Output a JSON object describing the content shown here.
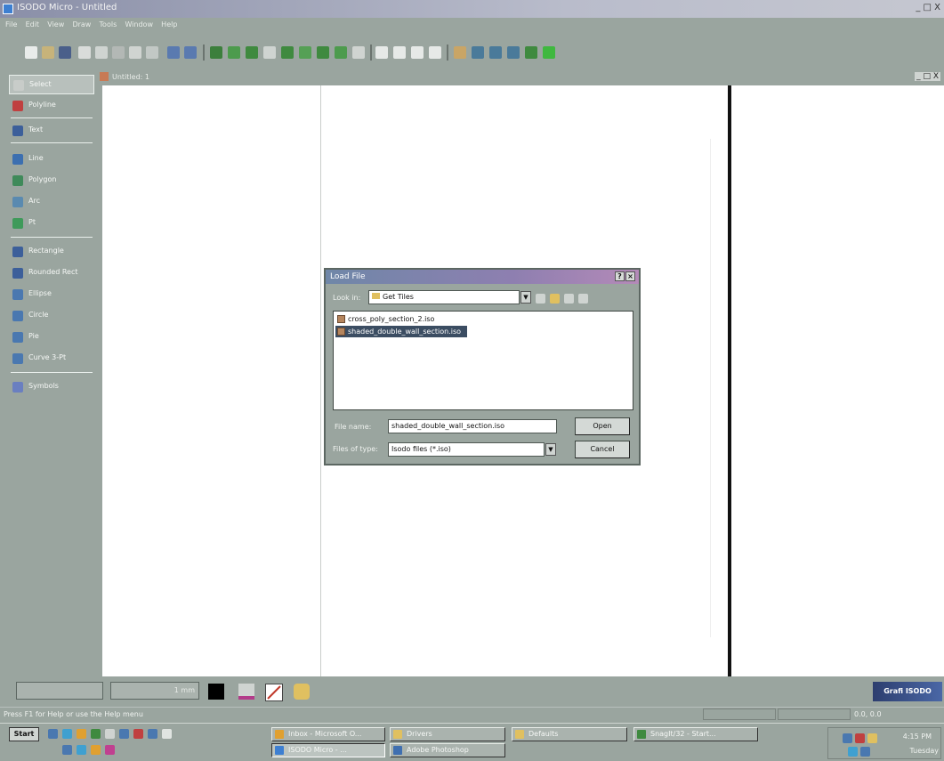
{
  "window": {
    "title": "ISODO Micro - Untitled",
    "controls": "_ □ X"
  },
  "menu": [
    "File",
    "Edit",
    "View",
    "Draw",
    "Tools",
    "Window",
    "Help"
  ],
  "toolbar_icons": [
    "new-icon",
    "open-icon",
    "save-icon",
    "print-icon",
    "print-preview-icon",
    "cut-icon",
    "copy-icon",
    "paste-icon",
    "undo-icon",
    "redo-icon",
    "pen-icon",
    "page-icon",
    "page2-icon",
    "delete-icon",
    "grid-icon",
    "layer-icon",
    "layer2-icon",
    "layer3-icon",
    "frame-icon",
    "zoom-in-icon",
    "zoom-out-icon",
    "zoom-fit-icon",
    "pan-icon",
    "grid-toggle-icon",
    "symbol-icon",
    "measure-icon",
    "rotate-icon",
    "mirror-icon",
    "flag-icon",
    "color-icon"
  ],
  "tools": [
    {
      "label": "Select",
      "icon": "select-arrow-icon",
      "selected": true
    },
    {
      "label": "Polyline",
      "icon": "polyline-icon"
    },
    {
      "label": "Text",
      "icon": "text-icon"
    },
    {
      "label": "Line",
      "icon": "line-icon"
    },
    {
      "label": "Polygon",
      "icon": "polygon-icon"
    },
    {
      "label": "Arc",
      "icon": "arc-icon"
    },
    {
      "label": "Pt",
      "icon": "point-icon"
    },
    {
      "label": "Rectangle",
      "icon": "rectangle-icon"
    },
    {
      "label": "Rounded Rect",
      "icon": "rounded-rect-icon"
    },
    {
      "label": "Ellipse",
      "icon": "ellipse-icon"
    },
    {
      "label": "Circle",
      "icon": "circle-icon"
    },
    {
      "label": "Pie",
      "icon": "pie-icon"
    },
    {
      "label": "Curve 3-Pt",
      "icon": "curve-icon"
    },
    {
      "label": "Symbols",
      "icon": "symbols-icon"
    }
  ],
  "document": {
    "title": "Untitled: 1",
    "controls": "_ □ X"
  },
  "dialog": {
    "title": "Load File",
    "look_in_label": "Look in:",
    "look_in_value": "Get Tiles",
    "files": [
      {
        "name": "cross_poly_section_2.iso",
        "selected": false
      },
      {
        "name": "shaded_double_wall_section.iso",
        "selected": true
      }
    ],
    "filename_label": "File name:",
    "filename_value": "shaded_double_wall_section.iso",
    "filetype_label": "Files of type:",
    "filetype_value": "Isodo files (*.iso)",
    "open_label": "Open",
    "cancel_label": "Cancel"
  },
  "status_fields": {
    "linewidth": "1 mm",
    "brand": "Grafi ISODO"
  },
  "statusbar": {
    "text": "Press F1 for Help or use the Help menu",
    "coords": "0.0, 0.0"
  },
  "taskbar": {
    "start": "Start",
    "tasks": [
      {
        "label": "Inbox - Microsoft O...",
        "icon": "mail-icon",
        "active": false
      },
      {
        "label": "Drivers",
        "icon": "folder-icon",
        "active": false
      },
      {
        "label": "Defaults",
        "icon": "folder-icon",
        "active": false
      },
      {
        "label": "SnagIt/32 - Start...",
        "icon": "snagit-icon",
        "active": false
      },
      {
        "label": "ISODO Micro - ...",
        "icon": "isodo-icon",
        "active": true
      },
      {
        "label": "Adobe Photoshop",
        "icon": "photoshop-icon",
        "active": false
      }
    ],
    "clock": [
      "4:15 PM",
      "Tuesday"
    ]
  },
  "colors": {
    "accent_blue": "#3d7fd1",
    "selection": "#3b4d62",
    "chrome": "#9aa59f"
  }
}
